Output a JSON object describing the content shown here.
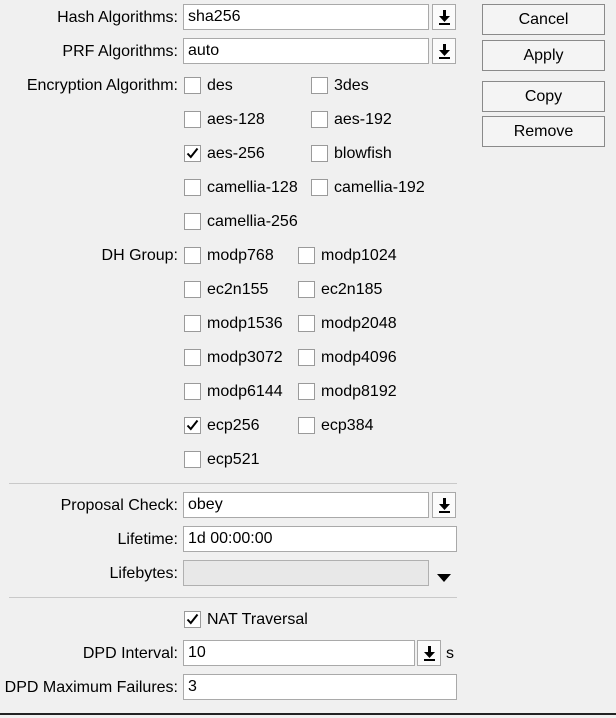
{
  "hash": {
    "label": "Hash Algorithms:",
    "value": "sha256"
  },
  "prf": {
    "label": "PRF Algorithms:",
    "value": "auto"
  },
  "encryption": {
    "label": "Encryption Algorithm:",
    "options": [
      {
        "label": "des",
        "checked": false
      },
      {
        "label": "3des",
        "checked": false
      },
      {
        "label": "aes-128",
        "checked": false
      },
      {
        "label": "aes-192",
        "checked": false
      },
      {
        "label": "aes-256",
        "checked": true
      },
      {
        "label": "blowfish",
        "checked": false
      },
      {
        "label": "camellia-128",
        "checked": false
      },
      {
        "label": "camellia-192",
        "checked": false
      },
      {
        "label": "camellia-256",
        "checked": false
      }
    ]
  },
  "dh": {
    "label": "DH Group:",
    "options": [
      {
        "label": "modp768",
        "checked": false
      },
      {
        "label": "modp1024",
        "checked": false
      },
      {
        "label": "ec2n155",
        "checked": false
      },
      {
        "label": "ec2n185",
        "checked": false
      },
      {
        "label": "modp1536",
        "checked": false
      },
      {
        "label": "modp2048",
        "checked": false
      },
      {
        "label": "modp3072",
        "checked": false
      },
      {
        "label": "modp4096",
        "checked": false
      },
      {
        "label": "modp6144",
        "checked": false
      },
      {
        "label": "modp8192",
        "checked": false
      },
      {
        "label": "ecp256",
        "checked": true
      },
      {
        "label": "ecp384",
        "checked": false
      },
      {
        "label": "ecp521",
        "checked": false
      }
    ]
  },
  "proposal_check": {
    "label": "Proposal Check:",
    "value": "obey"
  },
  "lifetime": {
    "label": "Lifetime:",
    "value": "1d 00:00:00"
  },
  "lifebytes": {
    "label": "Lifebytes:",
    "value": ""
  },
  "nat_traversal": {
    "label": "NAT Traversal",
    "checked": true
  },
  "dpd_interval": {
    "label": "DPD Interval:",
    "value": "10",
    "unit": "s"
  },
  "dpd_max_failures": {
    "label": "DPD Maximum Failures:",
    "value": "3"
  },
  "buttons": {
    "cancel": "Cancel",
    "apply": "Apply",
    "copy": "Copy",
    "remove": "Remove"
  }
}
